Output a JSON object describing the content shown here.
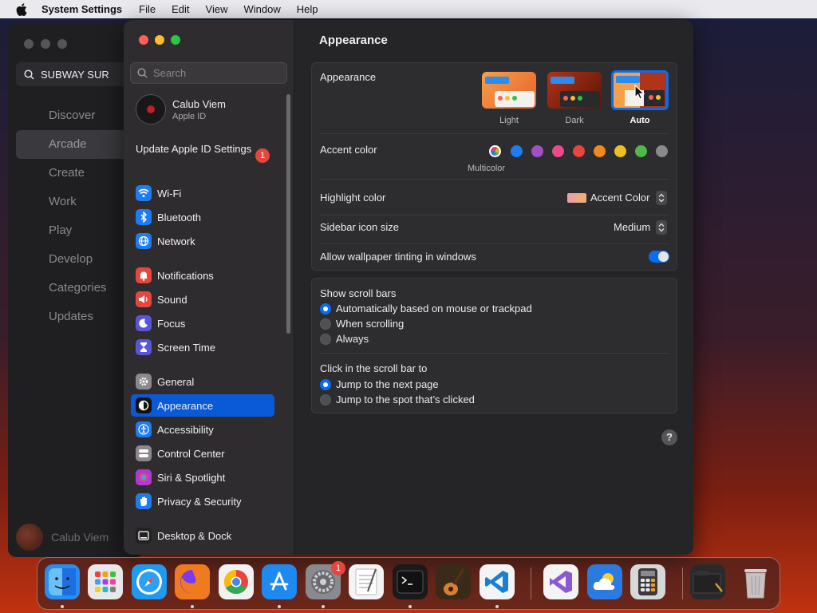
{
  "menubar": {
    "app_name": "System Settings",
    "items": [
      "File",
      "Edit",
      "View",
      "Window",
      "Help"
    ]
  },
  "background_app": {
    "search_text": "SUBWAY SUR",
    "nav": [
      "Discover",
      "Arcade",
      "Create",
      "Work",
      "Play",
      "Develop",
      "Categories",
      "Updates"
    ],
    "active_index": 1,
    "user_name": "Calub Viem"
  },
  "sidebar": {
    "search_placeholder": "Search",
    "account": {
      "name": "Calub Viem",
      "sub": "Apple ID"
    },
    "update_label": "Update Apple ID Settings",
    "update_badge": "1",
    "items": [
      {
        "label": "Wi-Fi",
        "icon": "wifi-icon",
        "color": "#1e7cf0"
      },
      {
        "label": "Bluetooth",
        "icon": "bluetooth-icon",
        "color": "#1e7cf0"
      },
      {
        "label": "Network",
        "icon": "globe-icon",
        "color": "#1e7cf0"
      },
      {
        "label": "Notifications",
        "icon": "bell-icon",
        "color": "#e8453c"
      },
      {
        "label": "Sound",
        "icon": "speaker-icon",
        "color": "#e8453c"
      },
      {
        "label": "Focus",
        "icon": "moon-icon",
        "color": "#5a55d6"
      },
      {
        "label": "Screen Time",
        "icon": "hourglass-icon",
        "color": "#5a55d6"
      },
      {
        "label": "General",
        "icon": "gear-icon",
        "color": "#8a8a8e"
      },
      {
        "label": "Appearance",
        "icon": "appearance-icon",
        "color": "#111111"
      },
      {
        "label": "Accessibility",
        "icon": "accessibility-icon",
        "color": "#1e7cf0"
      },
      {
        "label": "Control Center",
        "icon": "control-center-icon",
        "color": "#8a8a8e"
      },
      {
        "label": "Siri & Spotlight",
        "icon": "siri-icon",
        "color": "#b03ad0"
      },
      {
        "label": "Privacy & Security",
        "icon": "hand-icon",
        "color": "#1e7cf0"
      },
      {
        "label": "Desktop & Dock",
        "icon": "dock-icon",
        "color": "#222222"
      }
    ],
    "active_label": "Appearance"
  },
  "content": {
    "title": "Appearance",
    "appearance": {
      "label": "Appearance",
      "options": [
        "Light",
        "Dark",
        "Auto"
      ],
      "selected": "Auto"
    },
    "accent": {
      "label": "Accent color",
      "colors": [
        "#1e7cf0",
        "#a050c0",
        "#e84a8a",
        "#e8453c",
        "#f08a20",
        "#f0c020",
        "#50b848",
        "#8a8a8e"
      ],
      "multicolor_label": "Multicolor"
    },
    "highlight": {
      "label": "Highlight color",
      "value": "Accent Color"
    },
    "sidebar_icon": {
      "label": "Sidebar icon size",
      "value": "Medium"
    },
    "tinting": {
      "label": "Allow wallpaper tinting in windows",
      "on": true
    },
    "scrollbars": {
      "label": "Show scroll bars",
      "options": [
        "Automatically based on mouse or trackpad",
        "When scrolling",
        "Always"
      ],
      "selected": 0
    },
    "click_scroll": {
      "label": "Click in the scroll bar to",
      "options": [
        "Jump to the next page",
        "Jump to the spot that’s clicked"
      ],
      "selected": 0
    },
    "help": "?"
  },
  "dock": {
    "apps": [
      {
        "name": "finder-icon",
        "bg": "#2a8cf0",
        "running": true
      },
      {
        "name": "launchpad-icon",
        "bg": "#e8e8ea",
        "running": false
      },
      {
        "name": "safari-icon",
        "bg": "#1e9af0",
        "running": false
      },
      {
        "name": "firefox-icon",
        "bg": "#f07a20",
        "running": true
      },
      {
        "name": "chrome-icon",
        "bg": "#f2f2f2",
        "running": false
      },
      {
        "name": "app-store-icon",
        "bg": "#1e8af0",
        "running": true
      },
      {
        "name": "system-settings-icon",
        "bg": "#8a8a8e",
        "running": true,
        "badge": "1"
      },
      {
        "name": "textedit-icon",
        "bg": "#f4f4f4",
        "running": false
      },
      {
        "name": "terminal-icon",
        "bg": "#1a1a1a",
        "running": true
      },
      {
        "name": "garageband-icon",
        "bg": "#3a2a1a",
        "running": false
      },
      {
        "name": "vscode-icon",
        "bg": "#f4f4f4",
        "running": true
      },
      {
        "name": "visual-studio-icon",
        "bg": "#f4f4f4",
        "running": false
      },
      {
        "name": "weather-icon",
        "bg": "#2a7ae0",
        "running": false
      },
      {
        "name": "calculator-icon",
        "bg": "#d8d8d8",
        "running": false
      },
      {
        "name": "screenshot-folder-icon",
        "bg": "#2a2a2c",
        "running": false
      },
      {
        "name": "trash-icon",
        "bg": "transparent",
        "running": false
      }
    ]
  }
}
